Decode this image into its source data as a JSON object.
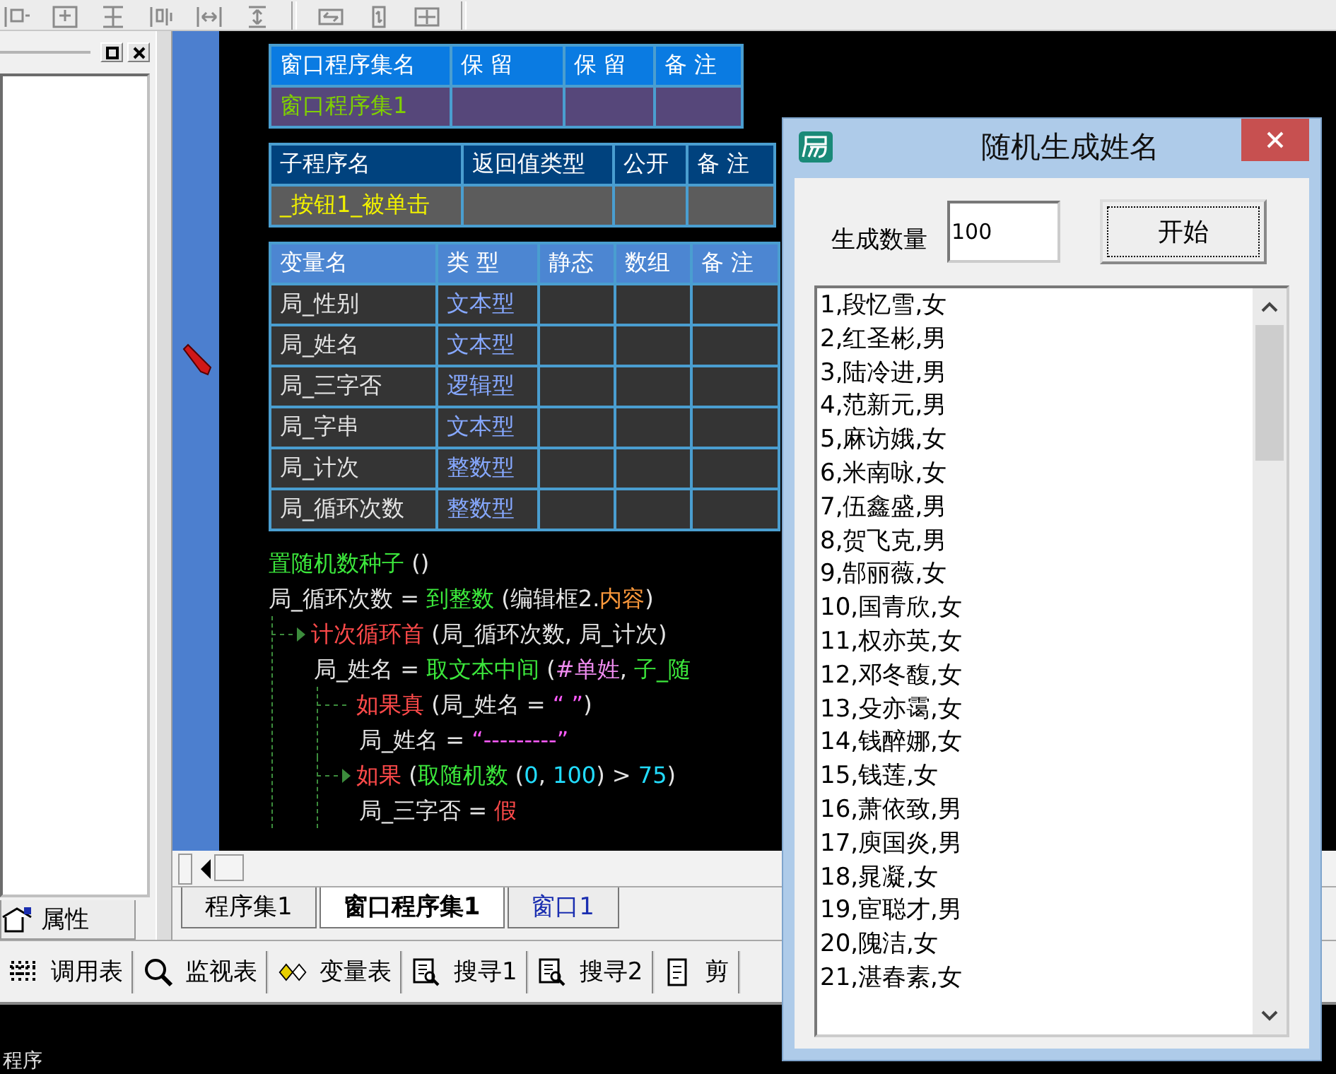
{
  "assembly_table": {
    "columns": [
      "窗口程序集名",
      "保 留",
      "保 留",
      "备 注"
    ],
    "rows": [
      {
        "cells": [
          "窗口程序集1",
          "",
          "",
          ""
        ]
      }
    ]
  },
  "sub_table": {
    "columns": [
      "子程序名",
      "返回值类型",
      "公开",
      "备 注"
    ],
    "rows": [
      {
        "cells": [
          "_按钮1_被单击",
          "",
          "",
          ""
        ]
      }
    ]
  },
  "var_table": {
    "columns": [
      "变量名",
      "类 型",
      "静态",
      "数组",
      "备 注"
    ],
    "rows": [
      {
        "name": "局_性别",
        "type": "文本型"
      },
      {
        "name": "局_姓名",
        "type": "文本型"
      },
      {
        "name": "局_三字否",
        "type": "逻辑型"
      },
      {
        "name": "局_字串",
        "type": "文本型"
      },
      {
        "name": "局_计次",
        "type": "整数型"
      },
      {
        "name": "局_循环次数",
        "type": "整数型"
      }
    ]
  },
  "code": [
    {
      "kind": "statement",
      "tokens": [
        {
          "kind": "command",
          "text": "置随机数种子"
        },
        {
          "kind": "plain",
          "text": " ()"
        }
      ]
    },
    {
      "kind": "statement",
      "tokens": [
        {
          "kind": "plain",
          "text": "局_循环次数 = "
        },
        {
          "kind": "command",
          "text": "到整数"
        },
        {
          "kind": "plain",
          "text": " (编辑框2."
        },
        {
          "kind": "property",
          "text": "内容"
        },
        {
          "kind": "plain",
          "text": ")"
        }
      ]
    },
    {
      "kind": "loop",
      "tokens": [
        {
          "kind": "flow",
          "text": "计次循环首"
        },
        {
          "kind": "plain",
          "text": " (局_循环次数, 局_计次)"
        }
      ],
      "children": [
        {
          "kind": "statement",
          "tokens": [
            {
              "kind": "plain",
              "text": "局_姓名 = "
            },
            {
              "kind": "command",
              "text": "取文本中间"
            },
            {
              "kind": "plain",
              "text": " ("
            },
            {
              "kind": "constant",
              "text": "#单姓"
            },
            {
              "kind": "plain",
              "text": ", "
            },
            {
              "kind": "command",
              "text": "子_随"
            }
          ]
        },
        {
          "kind": "if_true",
          "tokens": [
            {
              "kind": "flow",
              "text": "如果真"
            },
            {
              "kind": "plain",
              "text": " (局_姓名 = "
            },
            {
              "kind": "string",
              "text": "“ ”"
            },
            {
              "kind": "plain",
              "text": ")"
            }
          ],
          "children": [
            {
              "kind": "statement",
              "tokens": [
                {
                  "kind": "plain",
                  "text": "局_姓名 = "
                },
                {
                  "kind": "string",
                  "text": "“---------”"
                }
              ]
            }
          ]
        },
        {
          "kind": "if",
          "tokens": [
            {
              "kind": "flow",
              "text": "如果"
            },
            {
              "kind": "plain",
              "text": " ("
            },
            {
              "kind": "command",
              "text": "取随机数"
            },
            {
              "kind": "plain",
              "text": " ("
            },
            {
              "kind": "number",
              "text": "0"
            },
            {
              "kind": "plain",
              "text": ", "
            },
            {
              "kind": "number",
              "text": "100"
            },
            {
              "kind": "plain",
              "text": ") > "
            },
            {
              "kind": "number",
              "text": "75"
            },
            {
              "kind": "plain",
              "text": ")"
            }
          ],
          "children": [
            {
              "kind": "statement",
              "tokens": [
                {
                  "kind": "plain",
                  "text": "局_三字否 = "
                },
                {
                  "kind": "flow",
                  "text": "假"
                }
              ]
            }
          ]
        }
      ]
    }
  ],
  "left_panel": {
    "tab": "属性"
  },
  "editor_tabs": [
    {
      "label": "程序集1",
      "kind": "code",
      "selected": false
    },
    {
      "label": "窗口程序集1",
      "kind": "code",
      "selected": true
    },
    {
      "label": "窗口1",
      "kind": "window",
      "selected": false
    }
  ],
  "bottom_toolbar": [
    {
      "kind": "calls",
      "label": "调用表"
    },
    {
      "kind": "watch",
      "label": "监视表"
    },
    {
      "kind": "vars",
      "label": "变量表"
    },
    {
      "kind": "search",
      "label": "搜寻1"
    },
    {
      "kind": "search",
      "label": "搜寻2"
    },
    {
      "kind": "clip",
      "label": "剪"
    }
  ],
  "output_panel": {
    "text": "程序"
  },
  "dialog": {
    "title": "随机生成姓名",
    "count_label": "生成数量",
    "count_value": "100",
    "start_button": "开始",
    "results": [
      "1,段忆雪,女",
      "2,红圣彬,男",
      "3,陆冷进,男",
      "4,范新元,男",
      "5,麻访娥,女",
      "6,米南咏,女",
      "7,伍鑫盛,男",
      "8,贺飞克,男",
      "9,郜丽薇,女",
      "10,国青欣,女",
      "11,权亦英,女",
      "12,邓冬馥,女",
      "13,殳亦霭,女",
      "14,钱醉娜,女",
      "15,钱莲,女",
      "16,萧依致,男",
      "17,庾国炎,男",
      "18,晁凝,女",
      "19,宦聪才,男",
      "20,隗洁,女",
      "21,湛春素,女"
    ]
  }
}
